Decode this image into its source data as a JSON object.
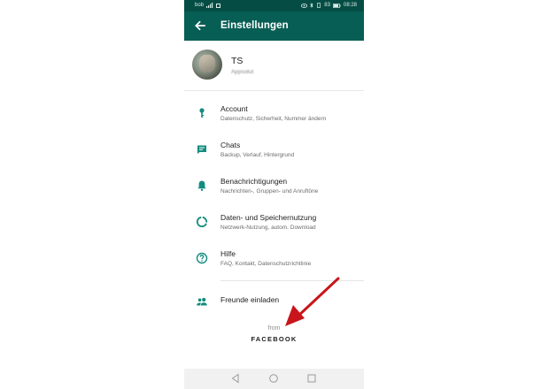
{
  "status_bar": {
    "carrier": "bob",
    "battery": "83",
    "time": "08:28"
  },
  "app_bar": {
    "title": "Einstellungen"
  },
  "profile": {
    "name": "TS",
    "status": "Appsolut"
  },
  "settings": [
    {
      "icon": "key-icon",
      "title": "Account",
      "subtitle": "Datenschutz, Sicherheit, Nummer ändern"
    },
    {
      "icon": "chat-icon",
      "title": "Chats",
      "subtitle": "Backup, Verlauf, Hintergrund"
    },
    {
      "icon": "bell-icon",
      "title": "Benachrichtigungen",
      "subtitle": "Nachrichten-, Gruppen- und Anruftöne"
    },
    {
      "icon": "data-usage-icon",
      "title": "Daten- und Speichernutzung",
      "subtitle": "Netzwerk-Nutzung, autom. Download"
    },
    {
      "icon": "help-icon",
      "title": "Hilfe",
      "subtitle": "FAQ, Kontakt, Datenschutzrichtlinie"
    }
  ],
  "invite": {
    "icon": "people-icon",
    "title": "Freunde einladen"
  },
  "footer": {
    "from": "from",
    "brand": "FACEBOOK"
  },
  "colors": {
    "header": "#075e54",
    "status_bar": "#054d44",
    "icon_teal": "#128c7e",
    "annotation_arrow": "#c8151b"
  }
}
